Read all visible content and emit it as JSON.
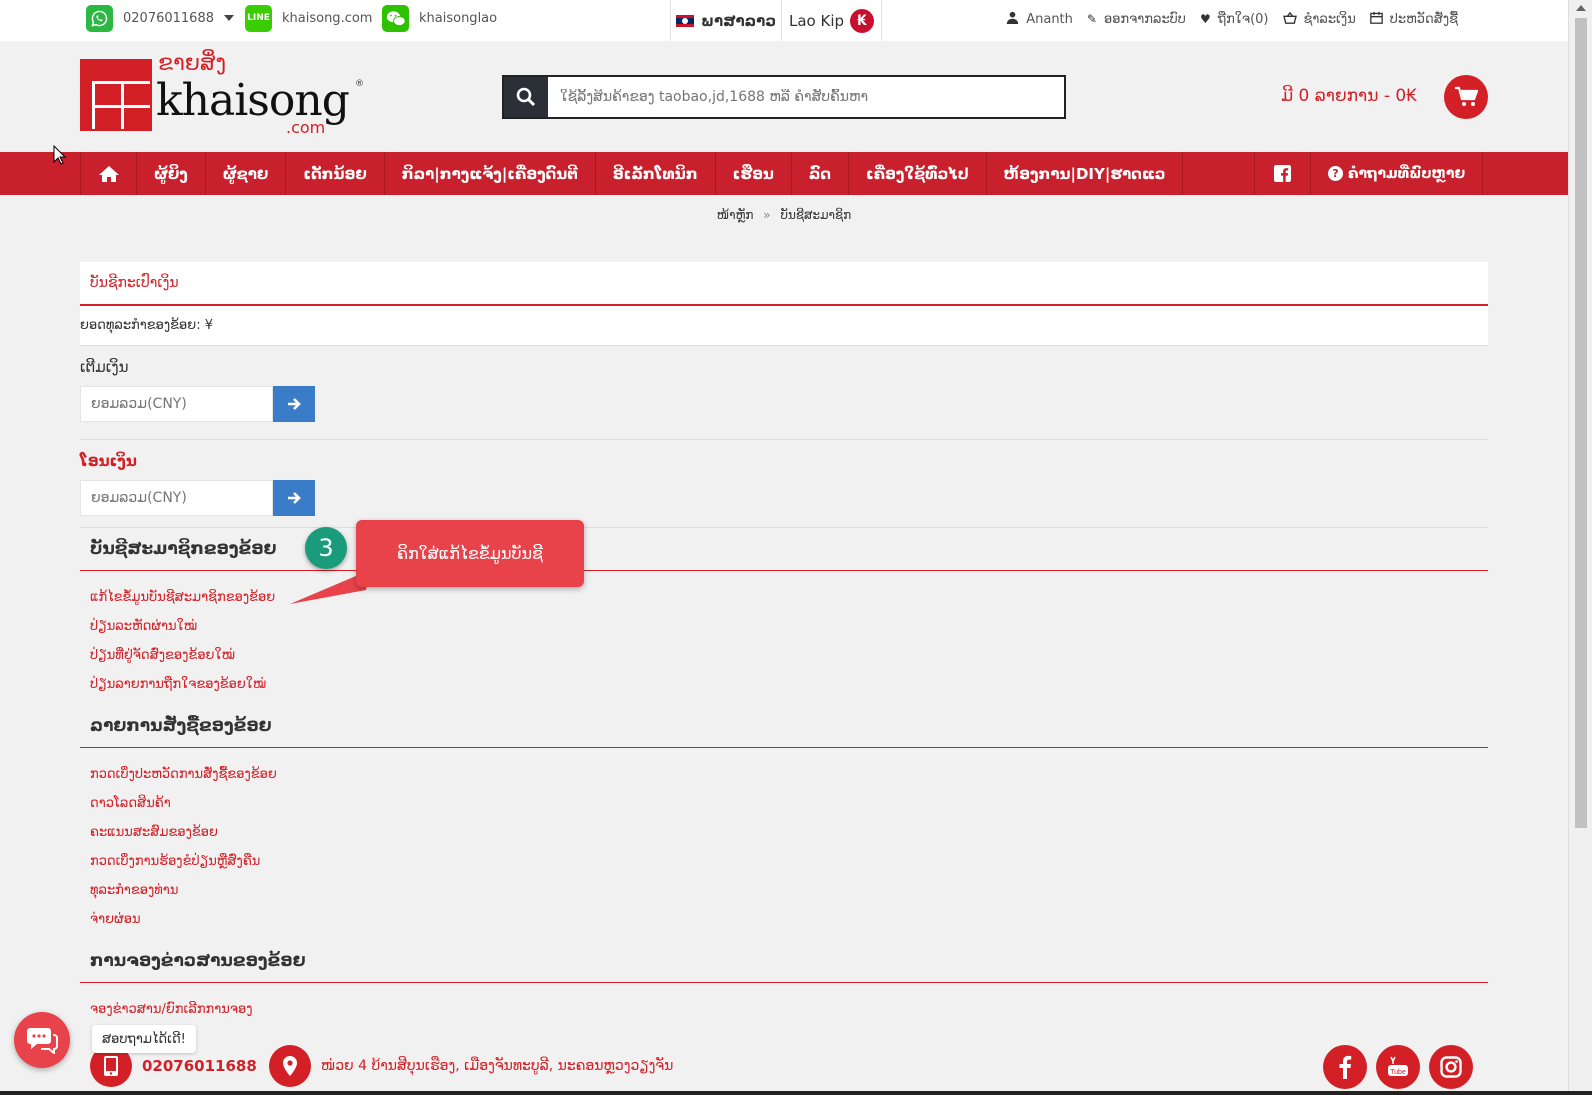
{
  "topbar": {
    "phone": "02076011688",
    "line_id": "khaisong.com",
    "wechat_id": "khaisonglao",
    "language": "ພາສາລາວ",
    "currency": "Lao Kip",
    "currency_symbol": "₭",
    "user_name": "Ananth",
    "logout": "ອອກຈາກລະບົບ",
    "wishlist": "ຖືກໃຈ(0)",
    "checkout": "ຊໍາລະເງິນ",
    "order_history": "ປະຫວັດສັ່ງຊື້"
  },
  "header": {
    "logo_lao": "ຂາຍສິ່ງ",
    "logo_name": "khaisong",
    "logo_com": ".com",
    "logo_registered": "®",
    "search_placeholder": "ໃຊ້ລິ້ງສິນຄ້າຂອງ taobao,jd,1688 ຫລື ຄໍາສັບຄົ້ນຫາ",
    "cart_text": "ມີ 0 ລາຍການ - 0₭"
  },
  "nav": {
    "items": [
      {
        "label": "ຜູ້ຍິງ"
      },
      {
        "label": "ຜູ້ຊາຍ"
      },
      {
        "label": "ເດັກນ້ອຍ"
      },
      {
        "label": "ກິລາ|ກາງແຈ້ງ|ເຄື່ອງດົນຕີ"
      },
      {
        "label": "ອີເລັກໂທນິກ"
      },
      {
        "label": "ເຮືອນ"
      },
      {
        "label": "ລົດ"
      },
      {
        "label": "ເຄື່ອງໃຊ້ທົ່ວໄປ"
      },
      {
        "label": "ຫ້ອງການ|DIY|ຮາດແວ"
      }
    ],
    "faq": "ຄໍາຖາມທີ່ພົບຫຼາຍ"
  },
  "breadcrumb": {
    "home": "ໜ້າຫຼັກ",
    "separator": "»",
    "current": "ບັນຊີສະມາຊິກ"
  },
  "wallet": {
    "title": "ບັນຊີກະເປົາເງິນ",
    "balance_label": "ຍອດທຸລະກໍາຂອງຂ້ອຍ: ¥",
    "topup_title": "ເຕີມເງິນ",
    "topup_placeholder": "ຍອມລວມ(CNY)",
    "transfer_title": "ໂອນເງິນ",
    "transfer_placeholder": "ຍອມລວມ(CNY)"
  },
  "account_section": {
    "title": "ບັນຊີສະມາຊິກຂອງຂ້ອຍ",
    "links": [
      "ແກ້ໄຂຂໍ້ມູນບັນຊີສະມາຊິກຂອງຂ້ອຍ",
      "ປ່ຽນລະຫັດຜ່ານໃໝ່",
      "ປ່ຽນທີ່ຢູ່ຈັດສົ່ງຂອງຂ້ອຍໃໝ່",
      "ປ່ຽນລາຍການຖືກໃຈຂອງຂ້ອຍໃໝ່"
    ]
  },
  "orders_section": {
    "title": "ລາຍການສັ່ງຊື້ຂອງຂ້ອຍ",
    "links": [
      "ກວດເບິ່ງປະຫວັດການສັ່ງຊື້ຂອງຂ້ອຍ",
      "ດາວໂລດສິນຄ້າ",
      "ຄະແນນສະສົມຂອງຂ້ອຍ",
      "ກວດເບິ່ງການຮ້ອງຂໍປ່ຽນຫຼືສົ່ງຄືນ",
      "ທຸລະກໍາຂອງທ່ານ",
      "ຈ່າຍຜ່ອນ"
    ]
  },
  "newsletter_section": {
    "title": "ການຈອງຂ່າວສານຂອງຂ້ອຍ",
    "links": [
      "ຈອງຂ່າວສານ/ຍົກເລີກການຈອງ"
    ]
  },
  "tutorial": {
    "step": "3",
    "text": "ຄິກໃສ່ແກ້ໄຂຂໍ້ມູນບັນຊີ"
  },
  "footer": {
    "phone": "02076011688",
    "address": "ໜ່ວຍ 4 ບ້ານສີບຸນເຮືອງ, ເມືອງຈັນທະບູລີ, ນະຄອນຫຼວງວຽງຈັນ"
  },
  "chat": {
    "label": "ສອບຖາມໄດ້ເດີ!"
  },
  "colors": {
    "brand_red": "#d32027",
    "nav_red": "#c8202c",
    "button_blue": "#3a7cc7",
    "badge_green": "#1a9b7c"
  }
}
